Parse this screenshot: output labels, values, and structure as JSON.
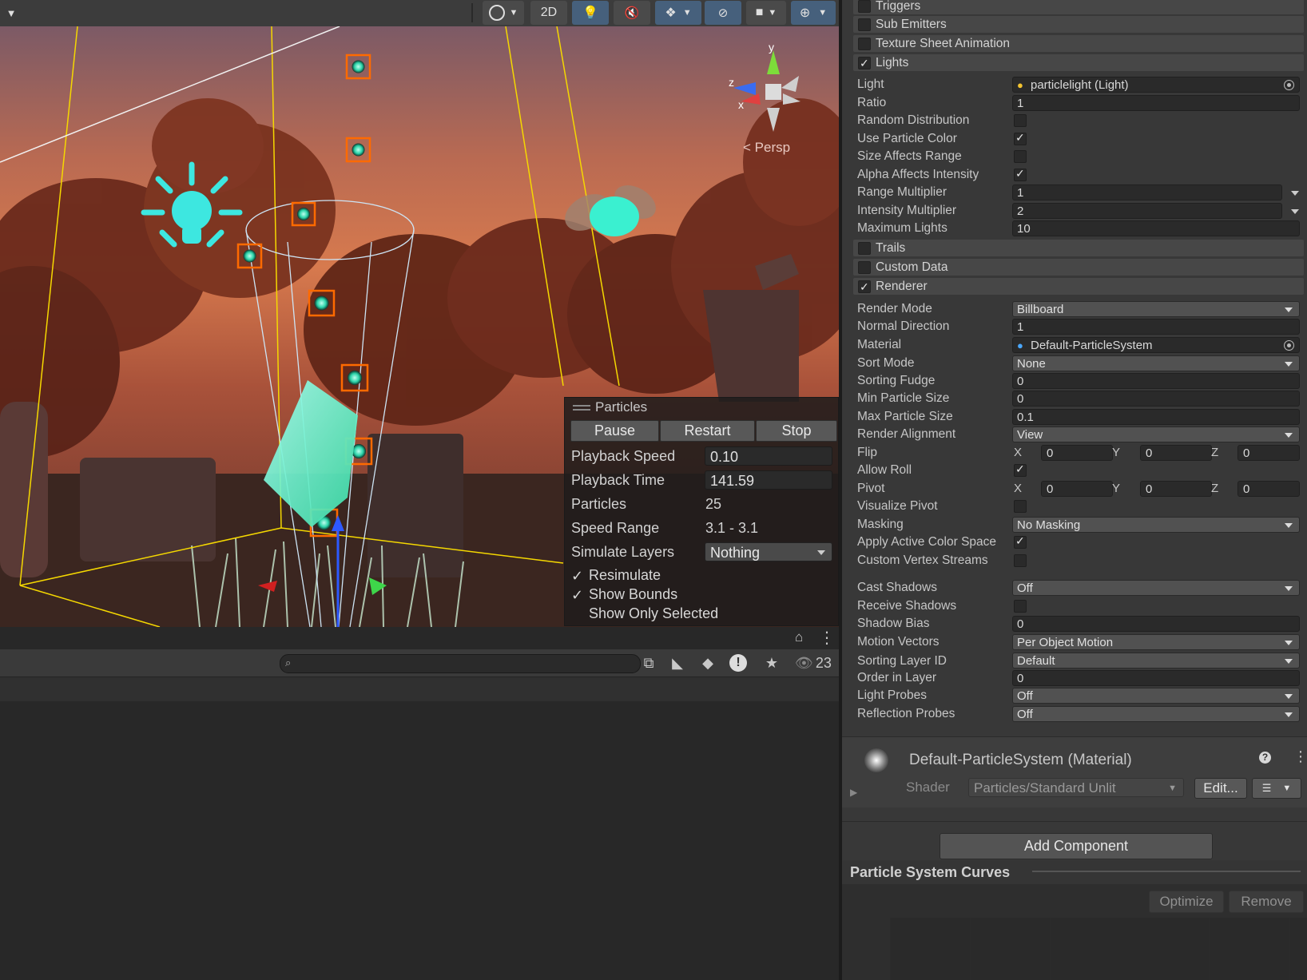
{
  "toolbar": {
    "btn_2d": "2D"
  },
  "scene": {
    "persp_label": "Persp",
    "axis_y": "y",
    "axis_z": "z",
    "axis_x": "x"
  },
  "particles_overlay": {
    "title": "Particles",
    "pause": "Pause",
    "restart": "Restart",
    "stop": "Stop",
    "playback_speed_label": "Playback Speed",
    "playback_speed": "0.10",
    "playback_time_label": "Playback Time",
    "playback_time": "141.59",
    "particles_label": "Particles",
    "particles": "25",
    "speed_range_label": "Speed Range",
    "speed_range": "3.1 - 3.1",
    "simulate_layers_label": "Simulate Layers",
    "simulate_layers": "Nothing",
    "resimulate": "Resimulate",
    "resimulate_checked": true,
    "show_bounds": "Show Bounds",
    "show_bounds_checked": true,
    "show_only_selected": "Show Only Selected",
    "show_only_selected_checked": false
  },
  "console": {
    "visible_count": "23"
  },
  "inspector": {
    "modules": {
      "triggers": "Triggers",
      "sub_emitters": "Sub Emitters",
      "texture_sheet": "Texture Sheet Animation",
      "lights": "Lights",
      "trails": "Trails",
      "custom_data": "Custom Data",
      "renderer": "Renderer"
    },
    "lights": {
      "light_label": "Light",
      "light_value": "particlelight (Light)",
      "ratio_label": "Ratio",
      "ratio": "1",
      "random_distribution_label": "Random Distribution",
      "use_particle_color_label": "Use Particle Color",
      "size_affects_range_label": "Size Affects Range",
      "alpha_affects_intensity_label": "Alpha Affects Intensity",
      "range_multiplier_label": "Range Multiplier",
      "range_multiplier": "1",
      "intensity_multiplier_label": "Intensity Multiplier",
      "intensity_multiplier": "2",
      "maximum_lights_label": "Maximum Lights",
      "maximum_lights": "10"
    },
    "renderer": {
      "render_mode_label": "Render Mode",
      "render_mode": "Billboard",
      "normal_direction_label": "Normal Direction",
      "normal_direction": "1",
      "material_label": "Material",
      "material": "Default-ParticleSystem",
      "sort_mode_label": "Sort Mode",
      "sort_mode": "None",
      "sorting_fudge_label": "Sorting Fudge",
      "sorting_fudge": "0",
      "min_particle_size_label": "Min Particle Size",
      "min_particle_size": "0",
      "max_particle_size_label": "Max Particle Size",
      "max_particle_size": "0.1",
      "render_alignment_label": "Render Alignment",
      "render_alignment": "View",
      "flip_label": "Flip",
      "flip_x": "0",
      "flip_y": "0",
      "flip_z": "0",
      "allow_roll_label": "Allow Roll",
      "pivot_label": "Pivot",
      "pivot_x": "0",
      "pivot_y": "0",
      "pivot_z": "0",
      "visualize_pivot_label": "Visualize Pivot",
      "masking_label": "Masking",
      "masking": "No Masking",
      "apply_active_color_space_label": "Apply Active Color Space",
      "custom_vertex_streams_label": "Custom Vertex Streams",
      "cast_shadows_label": "Cast Shadows",
      "cast_shadows": "Off",
      "receive_shadows_label": "Receive Shadows",
      "shadow_bias_label": "Shadow Bias",
      "shadow_bias": "0",
      "motion_vectors_label": "Motion Vectors",
      "motion_vectors": "Per Object Motion",
      "sorting_layer_id_label": "Sorting Layer ID",
      "sorting_layer_id": "Default",
      "order_in_layer_label": "Order in Layer",
      "order_in_layer": "0",
      "light_probes_label": "Light Probes",
      "light_probes": "Off",
      "reflection_probes_label": "Reflection Probes",
      "reflection_probes": "Off"
    },
    "x_label": "X",
    "y_label": "Y",
    "z_label": "Z",
    "material_panel": {
      "title": "Default-ParticleSystem (Material)",
      "shader_label": "Shader",
      "shader": "Particles/Standard Unlit",
      "edit": "Edit..."
    },
    "add_component": "Add Component",
    "curves_title": "Particle System Curves",
    "optimize": "Optimize",
    "remove": "Remove"
  }
}
